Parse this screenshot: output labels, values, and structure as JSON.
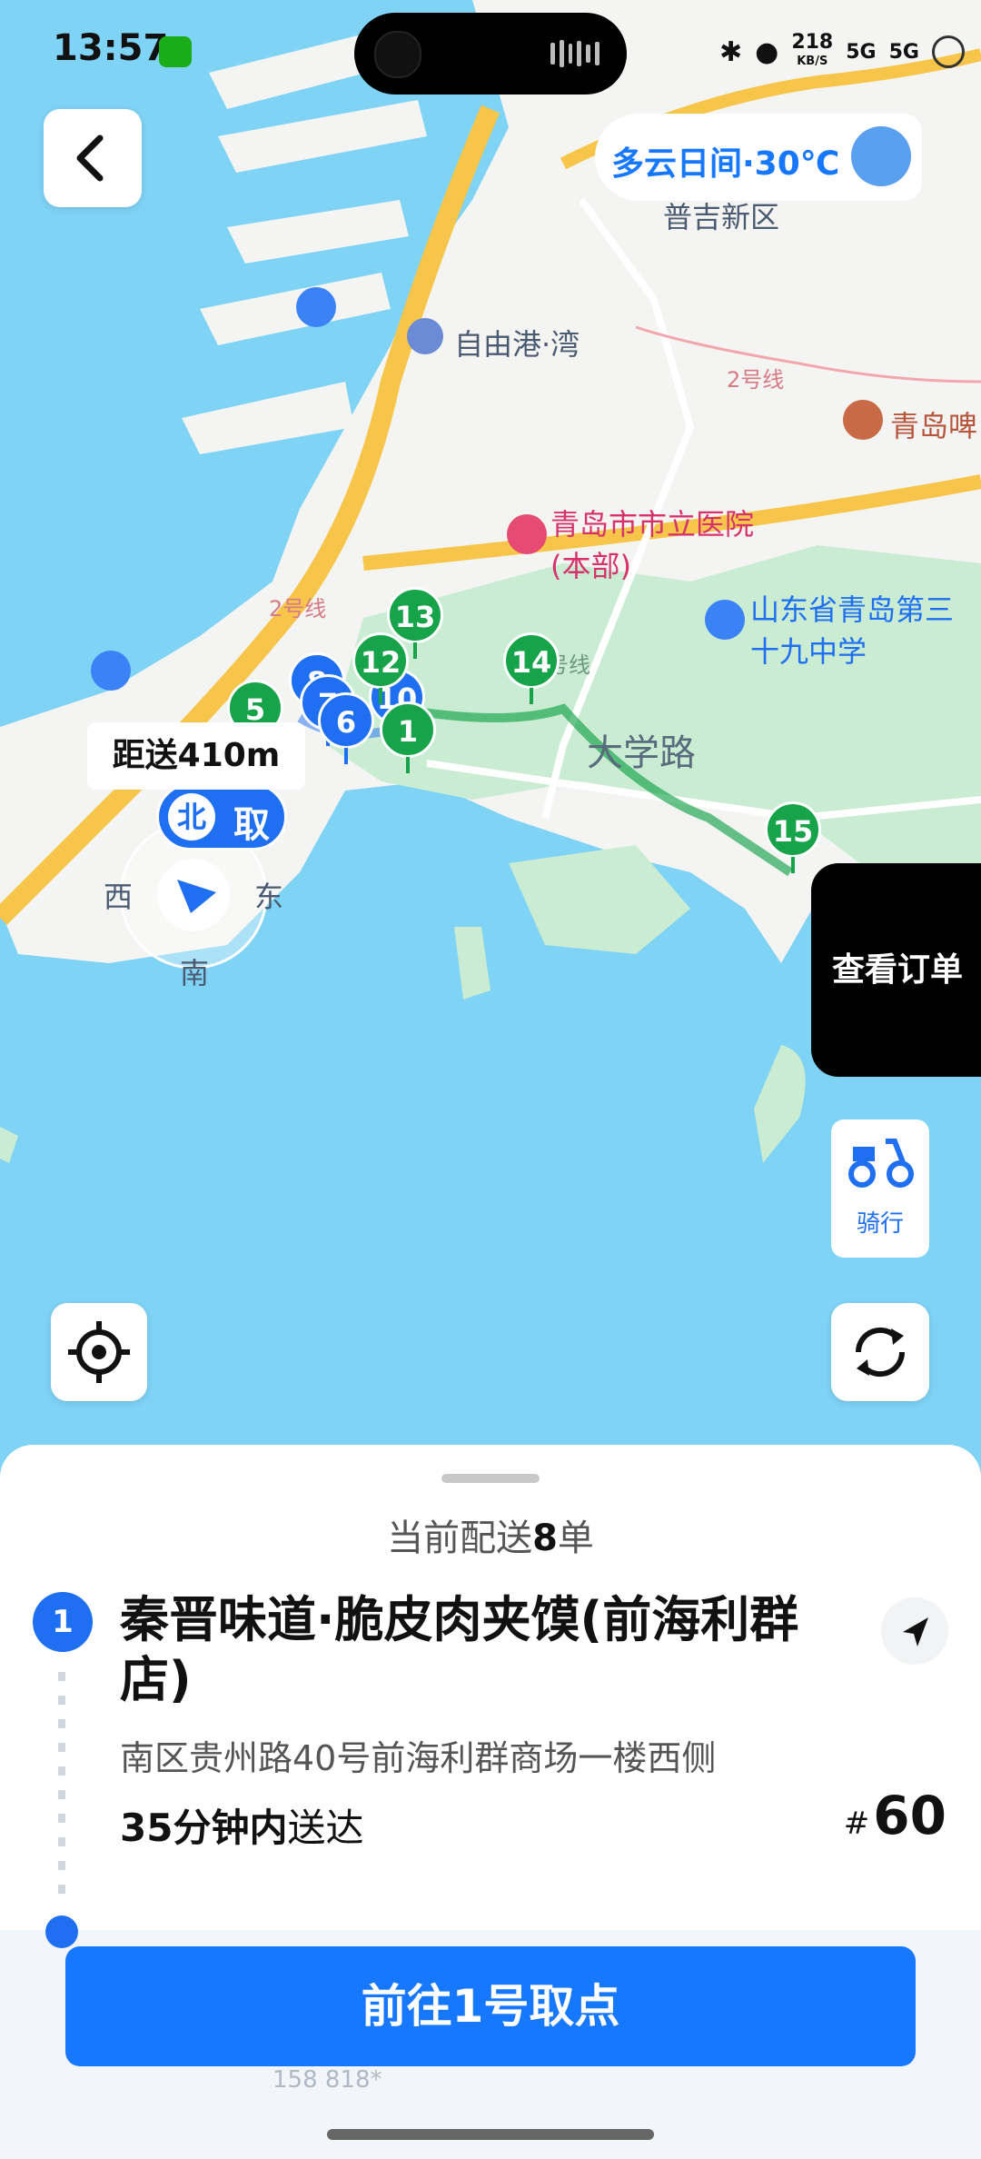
{
  "status_bar": {
    "time": "13:57",
    "net_speed": "218",
    "net_unit": "KB/S",
    "signal1": "5G",
    "signal2": "5G"
  },
  "weather": {
    "label": "多云日间·30℃"
  },
  "map": {
    "labels": {
      "district": "普吉新区",
      "free_port": "自由港·湾",
      "hospital": "青岛市市立医院(本部)",
      "school": "山东省青岛第三十九中学",
      "museum": "青岛啤",
      "road": "大学路",
      "line2_a": "2号线",
      "line2_b": "2号线",
      "line_c": "号线"
    },
    "distance": "距送410m",
    "compass": {
      "north": "北",
      "east": "东",
      "south": "南",
      "west": "西"
    },
    "pickup_marker": "取",
    "pins": [
      "5",
      "8",
      "7",
      "6",
      "10",
      "12",
      "13",
      "14",
      "15",
      "1"
    ]
  },
  "view_order_label": "查看订单",
  "ride_label": "骑行",
  "sheet": {
    "count_prefix": "当前配送",
    "count_value": "8",
    "count_suffix": "单",
    "step_number": "1",
    "shop_name": "秦晋味道·脆皮肉夹馍(前海利群店)",
    "address": "南区贵州路40号前海利群商场一楼西侧",
    "eta_bold": "35分钟内",
    "eta_rest": "送达",
    "order_hash": "#",
    "order_number": "60",
    "go_button": "前往1号取点",
    "ghost_text": "158   818*"
  },
  "colors": {
    "brand_blue": "#1677ff",
    "route_green": "#16a34a",
    "sea": "#7fd3f5",
    "land": "#f4f4f2"
  }
}
